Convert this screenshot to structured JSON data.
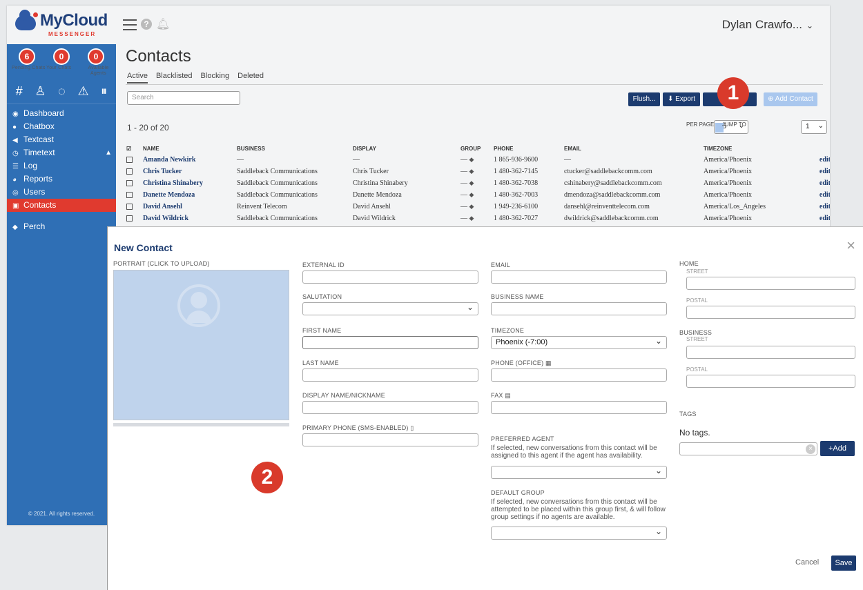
{
  "header": {
    "logo_text": "MyCloud",
    "logo_sub": "MESSENGER",
    "user_name": "Dylan Crawfo...",
    "user_chevron": "⌄"
  },
  "sidebar": {
    "stats": [
      {
        "count": "6",
        "label": "Pending Chats"
      },
      {
        "count": "0",
        "label": "Your Chats"
      },
      {
        "count": "0",
        "label": "Available Agents"
      }
    ],
    "icon_row": [
      "#",
      "♙",
      "◌",
      "⚠",
      "⏸"
    ],
    "items": [
      {
        "label": "Dashboard",
        "icon": "◉"
      },
      {
        "label": "Chatbox",
        "icon": "●"
      },
      {
        "label": "Textcast",
        "icon": "◀"
      },
      {
        "label": "Timetext",
        "icon": "◷"
      },
      {
        "label": "Log",
        "icon": "☰"
      },
      {
        "label": "Reports",
        "icon": "◕"
      },
      {
        "label": "Users",
        "icon": "◎"
      },
      {
        "label": "Contacts",
        "icon": "▣"
      },
      {
        "label": "Perch",
        "icon": "◆"
      }
    ],
    "footer": "© 2021. All rights reserved."
  },
  "page": {
    "title": "Contacts",
    "tabs": [
      "Active",
      "Blacklisted",
      "Blocking",
      "Deleted"
    ],
    "search_placeholder": "Search",
    "flush_label": "Flush...",
    "export_label": "Export",
    "add_contact_label": "Add Contact",
    "count_text": "1 - 20 of 20",
    "per_page_label": "PER PAGE",
    "per_page_value": "25",
    "page_indicator": "1",
    "jump_to_label": "JUMP TO",
    "jump_to_value": "1"
  },
  "table": {
    "columns": [
      "NAME",
      "BUSINESS",
      "DISPLAY",
      "GROUP",
      "PHONE",
      "EMAIL",
      "TIMEZONE"
    ],
    "rows": [
      {
        "name": "Amanda Newkirk",
        "business": "—",
        "display": "—",
        "group": "—",
        "phone": "1 865-936-9600",
        "email": "—",
        "timezone": "America/Phoenix",
        "action": "edit"
      },
      {
        "name": "Chris Tucker",
        "business": "Saddleback Communications",
        "display": "Chris Tucker",
        "group": "—",
        "phone": "1 480-362-7145",
        "email": "ctucker@saddlebackcomm.com",
        "timezone": "America/Phoenix",
        "action": "edit"
      },
      {
        "name": "Christina Shinabery",
        "business": "Saddleback Communications",
        "display": "Christina Shinabery",
        "group": "—",
        "phone": "1 480-362-7038",
        "email": "cshinabery@saddlebackcomm.com",
        "timezone": "America/Phoenix",
        "action": "edit"
      },
      {
        "name": "Danette Mendoza",
        "business": "Saddleback Communications",
        "display": "Danette Mendoza",
        "group": "—",
        "phone": "1 480-362-7003",
        "email": "dmendoza@saddlebackcomm.com",
        "timezone": "America/Phoenix",
        "action": "edit"
      },
      {
        "name": "David Ansehl",
        "business": "Reinvent Telecom",
        "display": "David Ansehl",
        "group": "—",
        "phone": "1 949-236-6100",
        "email": "dansehl@reinventtelecom.com",
        "timezone": "America/Los_Angeles",
        "action": "edit"
      },
      {
        "name": "David Wildrick",
        "business": "Saddleback Communications",
        "display": "David Wildrick",
        "group": "—",
        "phone": "1 480-362-7027",
        "email": "dwildrick@saddlebackcomm.com",
        "timezone": "America/Phoenix",
        "action": "edit"
      }
    ]
  },
  "callouts": {
    "one": "1",
    "two": "2"
  },
  "modal": {
    "title": "New Contact",
    "close": "×",
    "portrait_label": "PORTRAIT (CLICK TO UPLOAD)",
    "external_id": "EXTERNAL ID",
    "salutation": "SALUTATION",
    "first_name": "FIRST NAME",
    "last_name": "LAST NAME",
    "display_name": "DISPLAY NAME/NICKNAME",
    "primary_phone": "PRIMARY PHONE (SMS-ENABLED) ▯",
    "email": "EMAIL",
    "business_name": "BUSINESS NAME",
    "timezone": "TIMEZONE",
    "timezone_value": "Phoenix (-7:00)",
    "phone_office": "PHONE (OFFICE) ▦",
    "fax": "FAX ▤",
    "preferred_agent": "PREFERRED AGENT",
    "preferred_agent_help": "If selected, new conversations from this contact will be assigned to this agent if the agent has availability.",
    "default_group": "DEFAULT GROUP",
    "default_group_help": "If selected, new conversations from this contact will be attempted to be placed within this group first, & will follow group settings if no agents are available.",
    "home": "HOME",
    "business": "BUSINESS",
    "street": "STREET",
    "postal": "POSTAL",
    "tags": "TAGS",
    "no_tags": "No tags.",
    "add_label": "+Add",
    "clear": "×",
    "cancel": "Cancel",
    "save": "Save"
  },
  "colors": {
    "brand": "#2f6fb5",
    "accent": "#e03a2f",
    "navy": "#1c3b6f"
  }
}
